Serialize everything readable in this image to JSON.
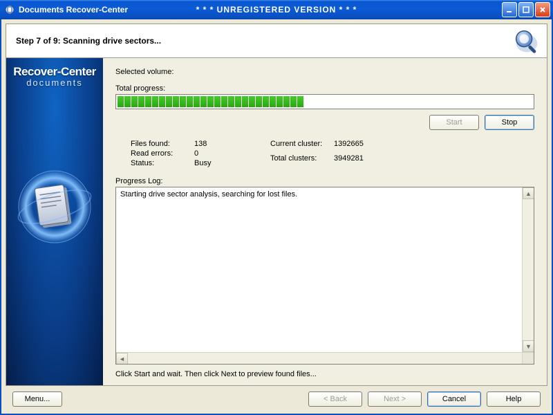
{
  "title": {
    "app_name": "Documents Recover-Center",
    "unregistered_banner": "* * * UNREGISTERED VERSION * * *"
  },
  "header": {
    "step_text": "Step 7 of 9: Scanning drive sectors..."
  },
  "sidebar": {
    "brand_line1": "Recover-Center",
    "brand_line2": "documents"
  },
  "content": {
    "selected_volume_label": "Selected volume:",
    "selected_volume_value": "",
    "total_progress_label": "Total progress:",
    "progress_blocks_filled": 27,
    "progress_blocks_total": 80,
    "buttons": {
      "start": "Start",
      "stop": "Stop"
    },
    "stats": {
      "files_found_label": "Files found:",
      "files_found_value": "138",
      "read_errors_label": "Read errors:",
      "read_errors_value": "0",
      "status_label": "Status:",
      "status_value": "Busy",
      "current_cluster_label": "Current cluster:",
      "current_cluster_value": "1392665",
      "total_clusters_label": "Total clusters:",
      "total_clusters_value": "3949281"
    },
    "progress_log_label": "Progress Log:",
    "progress_log_text": "Starting drive sector analysis, searching for lost files.",
    "hint": "Click Start and wait. Then click Next to preview found files..."
  },
  "footer": {
    "menu": "Menu...",
    "back": "< Back",
    "next": "Next >",
    "cancel": "Cancel",
    "help": "Help"
  }
}
